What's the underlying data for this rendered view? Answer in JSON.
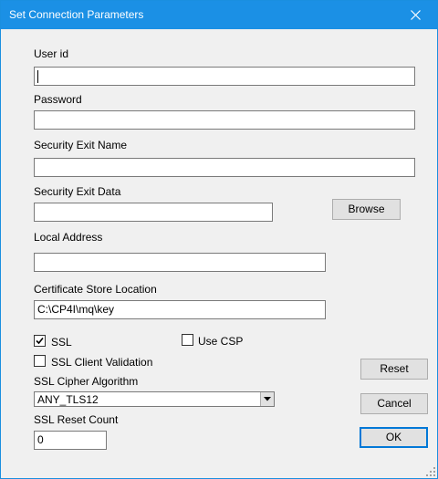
{
  "window": {
    "title": "Set Connection Parameters"
  },
  "fields": {
    "user_id": {
      "label": "User id",
      "value": ""
    },
    "password": {
      "label": "Password",
      "value": ""
    },
    "security_exit_name": {
      "label": "Security Exit Name",
      "value": ""
    },
    "security_exit_data": {
      "label": "Security Exit Data",
      "value": ""
    },
    "local_address": {
      "label": "Local Address",
      "value": ""
    },
    "cert_store": {
      "label": "Certificate Store Location",
      "value": "C:\\CP4I\\mq\\key"
    },
    "ssl_cipher": {
      "label": "SSL Cipher Algorithm",
      "value": "ANY_TLS12"
    },
    "ssl_reset_count": {
      "label": "SSL Reset Count",
      "value": "0"
    }
  },
  "checkboxes": {
    "ssl": {
      "label": "SSL",
      "checked": true
    },
    "use_csp": {
      "label": "Use CSP",
      "checked": false
    },
    "ssl_client_validation": {
      "label": "SSL Client Validation",
      "checked": false
    }
  },
  "buttons": {
    "browse": "Browse",
    "reset": "Reset",
    "cancel": "Cancel",
    "ok": "OK"
  },
  "icons": {
    "close": "close-icon",
    "dropdown": "chevron-down-icon",
    "check": "check-icon"
  },
  "colors": {
    "titlebar": "#1b90e5",
    "dialog_bg": "#f0f0f0",
    "default_button_border": "#0078d7"
  }
}
